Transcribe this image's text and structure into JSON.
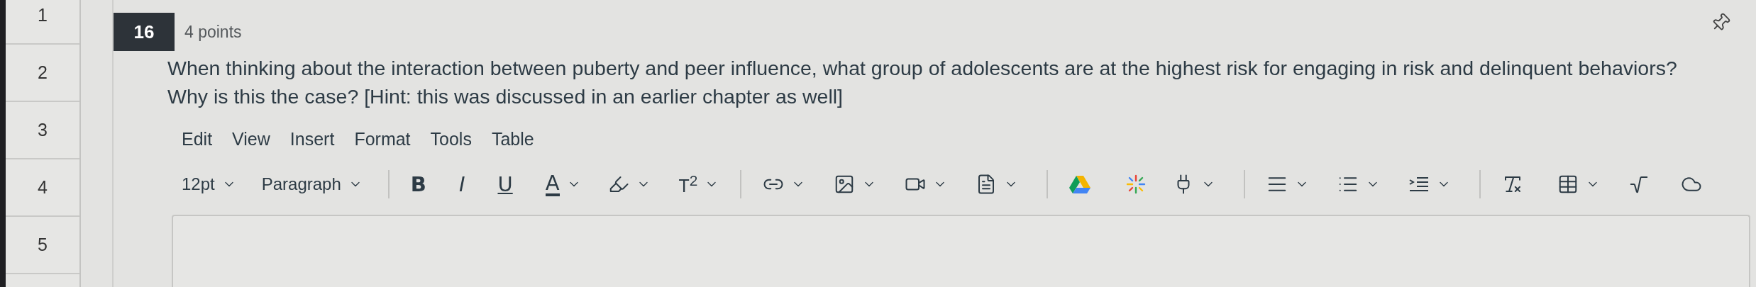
{
  "line_numbers": [
    "1",
    "2",
    "3",
    "4",
    "5"
  ],
  "question": {
    "number": "16",
    "points": "4 points",
    "text": "When thinking about the interaction between puberty and peer influence, what group of adolescents are at the highest risk for engaging in risk and delinquent behaviors?\nWhy is this the case? [Hint: this was discussed in an earlier chapter as well]"
  },
  "editor": {
    "menu": [
      "Edit",
      "View",
      "Insert",
      "Format",
      "Tools",
      "Table"
    ],
    "font_size": "12pt",
    "block_format": "Paragraph",
    "format_buttons": [
      {
        "label": "B",
        "kind": "bold"
      },
      {
        "label": "I",
        "kind": "italic"
      },
      {
        "label": "U",
        "kind": "underline"
      },
      {
        "label": "A",
        "kind": "color"
      }
    ],
    "superscript": "T$^{2}$"
  }
}
